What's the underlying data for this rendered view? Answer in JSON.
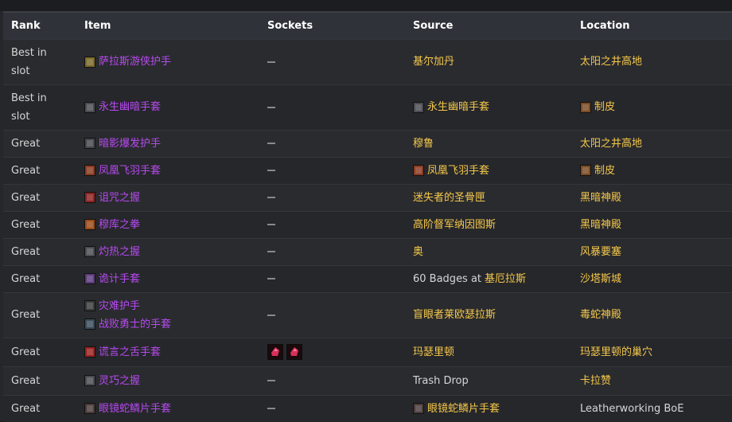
{
  "headers": {
    "rank": "Rank",
    "item": "Item",
    "sockets": "Sockets",
    "source": "Source",
    "location": "Location"
  },
  "colors": {
    "epic": "#b74af0",
    "gold": "#f5c84a",
    "socket_red": "#d8305a"
  },
  "rows": [
    {
      "rank": "Best in slot",
      "items": [
        {
          "name": "萨拉斯游侠护手",
          "icon": "gauntlet-icon",
          "icon_color": "#7a6a2a"
        }
      ],
      "sockets": [],
      "source": {
        "prefix": "",
        "name": "基尔加丹",
        "style": "gold",
        "icon": null
      },
      "location": {
        "name": "太阳之井高地",
        "icon": null
      }
    },
    {
      "rank": "Best in slot",
      "items": [
        {
          "name": "永生幽暗手套",
          "icon": "glove-icon",
          "icon_color": "#4a4a52"
        }
      ],
      "sockets": [],
      "source": {
        "prefix": "",
        "name": "永生幽暗手套",
        "style": "gold",
        "icon": "glove-icon",
        "icon_color": "#4a4a52"
      },
      "location": {
        "name": "制皮",
        "icon": "leather-icon",
        "icon_color": "#7a4a22"
      }
    },
    {
      "rank": "Great",
      "items": [
        {
          "name": "暗影爆发护手",
          "icon": "glove-icon",
          "icon_color": "#45464e"
        }
      ],
      "sockets": [],
      "source": {
        "prefix": "",
        "name": "穆鲁",
        "style": "gold",
        "icon": null
      },
      "location": {
        "name": "太阳之井高地",
        "icon": null
      }
    },
    {
      "rank": "Great",
      "items": [
        {
          "name": "凤凰飞羽手套",
          "icon": "phoenix-glove-icon",
          "icon_color": "#8a3a22"
        }
      ],
      "sockets": [],
      "source": {
        "prefix": "",
        "name": "凤凰飞羽手套",
        "style": "gold",
        "icon": "phoenix-glove-icon",
        "icon_color": "#8a3a22"
      },
      "location": {
        "name": "制皮",
        "icon": "leather-icon",
        "icon_color": "#7a4a22"
      }
    },
    {
      "rank": "Great",
      "items": [
        {
          "name": "诅咒之握",
          "icon": "cursed-glove-icon",
          "icon_color": "#8a2222"
        }
      ],
      "sockets": [],
      "source": {
        "prefix": "",
        "name": "迷失者的圣骨匣",
        "style": "gold",
        "icon": null
      },
      "location": {
        "name": "黑暗神殿",
        "icon": null
      }
    },
    {
      "rank": "Great",
      "items": [
        {
          "name": "穆库之拳",
          "icon": "fist-icon",
          "icon_color": "#9a4a1a"
        }
      ],
      "sockets": [],
      "source": {
        "prefix": "",
        "name": "高阶督军纳因图斯",
        "style": "gold",
        "icon": null
      },
      "location": {
        "name": "黑暗神殿",
        "icon": null
      }
    },
    {
      "rank": "Great",
      "items": [
        {
          "name": "灼热之握",
          "icon": "glove-icon",
          "icon_color": "#4a4a52"
        }
      ],
      "sockets": [],
      "source": {
        "prefix": "",
        "name": "奥",
        "style": "gold",
        "icon": null
      },
      "location": {
        "name": "风暴要塞",
        "icon": null
      }
    },
    {
      "rank": "Great",
      "items": [
        {
          "name": "诡计手套",
          "icon": "trick-glove-icon",
          "icon_color": "#5a3a7a"
        }
      ],
      "sockets": [],
      "source": {
        "prefix": "60 Badges at",
        "name": "基厄拉斯",
        "style": "gold",
        "icon": null
      },
      "location": {
        "name": "沙塔斯城",
        "icon": null
      }
    },
    {
      "rank": "Great",
      "items": [
        {
          "name": "灾难护手",
          "icon": "gauntlet-icon",
          "icon_color": "#3a3a3a"
        },
        {
          "name": "战败勇士的手套",
          "icon": "glove-icon",
          "icon_color": "#3a4a5a"
        }
      ],
      "sockets": [],
      "source": {
        "prefix": "",
        "name": "盲眼者莱欧瑟拉斯",
        "style": "gold",
        "icon": null
      },
      "location": {
        "name": "毒蛇神殿",
        "icon": null
      }
    },
    {
      "rank": "Great",
      "items": [
        {
          "name": "谎言之舌手套",
          "icon": "lie-glove-icon",
          "icon_color": "#9a2222"
        }
      ],
      "sockets": [
        "red-gem-socket-icon",
        "red-gem-socket-icon"
      ],
      "source": {
        "prefix": "",
        "name": "玛瑟里顿",
        "style": "gold",
        "icon": null
      },
      "location": {
        "name": "玛瑟里顿的巢穴",
        "icon": null
      }
    },
    {
      "rank": "Great",
      "items": [
        {
          "name": "灵巧之握",
          "icon": "glove-icon",
          "icon_color": "#4a4a52"
        }
      ],
      "sockets": [],
      "source": {
        "prefix": "",
        "name": "Trash Drop",
        "style": "plain",
        "icon": null
      },
      "location": {
        "name": "卡拉赞",
        "icon": null
      }
    },
    {
      "rank": "Great",
      "items": [
        {
          "name": "眼镜蛇鳞片手套",
          "icon": "snake-glove-icon",
          "icon_color": "#4a3a3a"
        }
      ],
      "sockets": [],
      "source": {
        "prefix": "",
        "name": "眼镜蛇鳞片手套",
        "style": "gold",
        "icon": "snake-glove-icon",
        "icon_color": "#4a3a3a"
      },
      "location": {
        "name": "Leatherworking BoE",
        "icon": null,
        "style": "plain"
      }
    }
  ]
}
